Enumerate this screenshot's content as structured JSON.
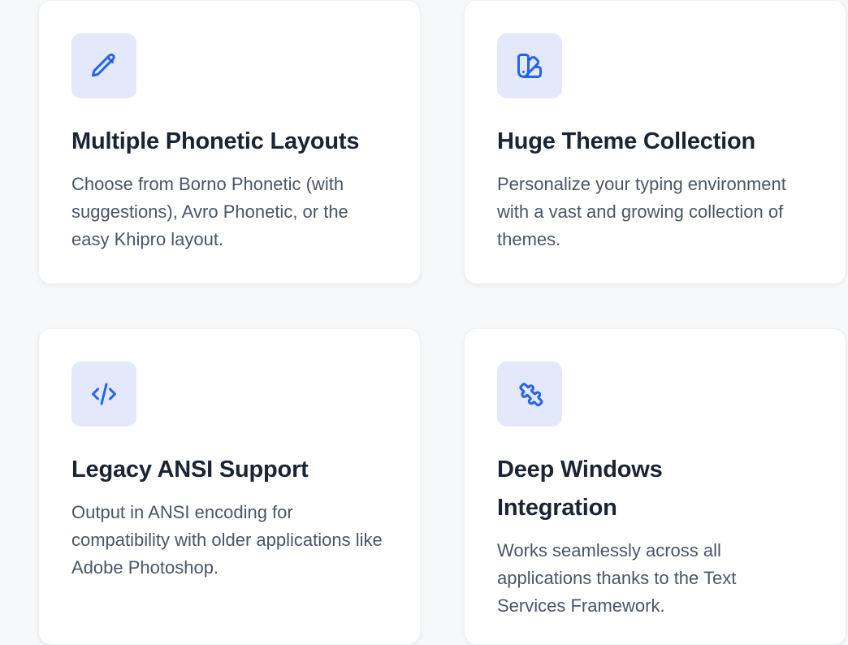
{
  "features": [
    {
      "icon": "pencil-icon",
      "title": "Multiple Phonetic Layouts",
      "description": "Choose from Borno Phonetic (with suggestions), Avro Phonetic, or the easy Khipro layout."
    },
    {
      "icon": "swatch-book-icon",
      "title": "Huge Theme Collection",
      "description": "Personalize your typing environment with a vast and growing collection of themes."
    },
    {
      "icon": "code-icon",
      "title": "Legacy ANSI Support",
      "description": "Output in ANSI encoding for compatibility with older applications like Adobe Photoshop."
    },
    {
      "icon": "puzzle-icon",
      "title": "Deep Windows Integration",
      "description": "Works seamlessly across all applications thanks to the Text Services Framework."
    }
  ],
  "colors": {
    "accent": "#2563eb",
    "icon_bg": "#e3e9fb",
    "title": "#1b2433",
    "text": "#4b5565",
    "page_bg": "#f7f8fa"
  }
}
